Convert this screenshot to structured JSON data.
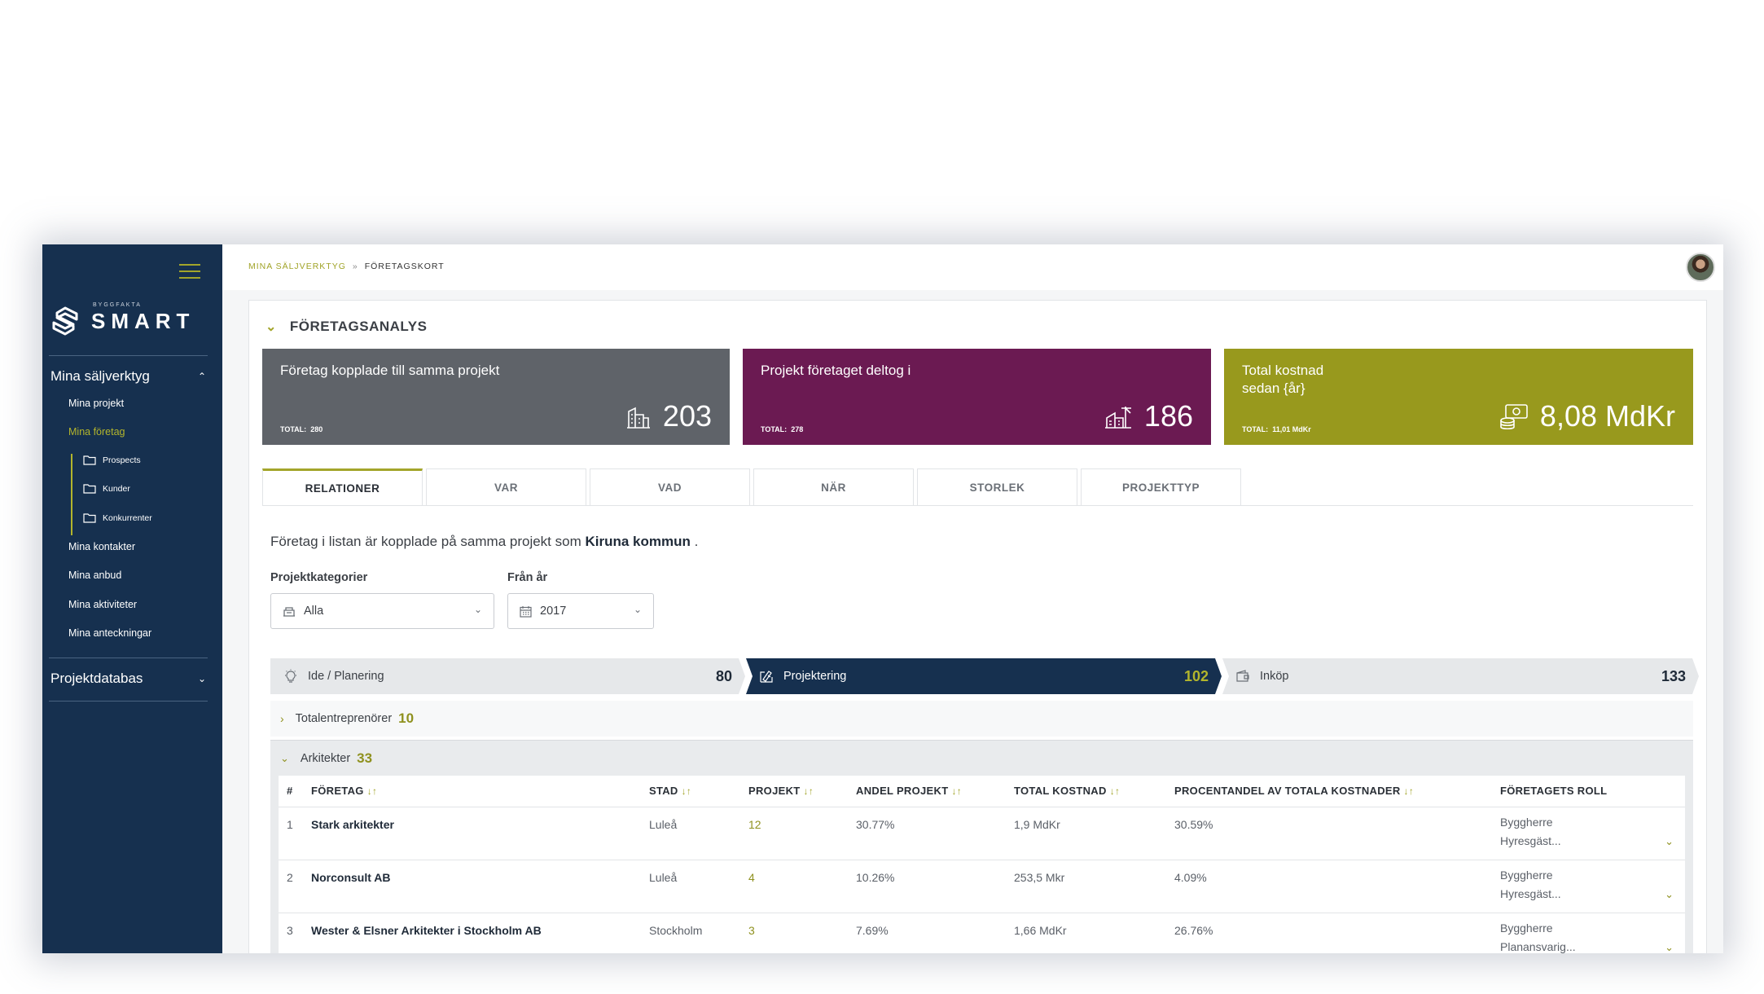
{
  "sidebar": {
    "logo_sub": "BYGGFAKTA",
    "logo_main": "SMART",
    "section1": "Mina säljverktyg",
    "items": [
      {
        "label": "Mina projekt"
      },
      {
        "label": "Mina företag"
      },
      {
        "label": "Mina kontakter"
      },
      {
        "label": "Mina anbud"
      },
      {
        "label": "Mina aktiviteter"
      },
      {
        "label": "Mina anteckningar"
      }
    ],
    "subitems": [
      {
        "label": "Prospects"
      },
      {
        "label": "Kunder"
      },
      {
        "label": "Konkurrenter"
      }
    ],
    "section2": "Projektdatabas"
  },
  "breadcrumb": {
    "root": "MINA SÄLJVERKTYG",
    "sep": "»",
    "current": "FÖRETAGSKORT"
  },
  "panel": {
    "title": "FÖRETAGSANALYS"
  },
  "cards": [
    {
      "title": "Företag kopplade till samma projekt",
      "total_label": "TOTAL:",
      "total": "280",
      "value": "203",
      "icon": "buildings-icon",
      "color": "#5f6369"
    },
    {
      "title": "Projekt företaget deltog i",
      "total_label": "TOTAL:",
      "total": "278",
      "value": "186",
      "icon": "construction-icon",
      "color": "#6b1a52"
    },
    {
      "title": "Total kostnad",
      "title2": "sedan {år}",
      "total_label": "TOTAL:",
      "total": "11,01 MdKr",
      "value": "8,08 MdKr",
      "icon": "money-icon",
      "color": "#98991d"
    }
  ],
  "tabs": [
    "RELATIONER",
    "VAR",
    "VAD",
    "NÄR",
    "STORLEK",
    "PROJEKTTYP"
  ],
  "info": {
    "pre": "Företag i listan är kopplade på samma projekt som",
    "company": "Kiruna kommun",
    "post": "."
  },
  "filters": {
    "category_label": "Projektkategorier",
    "category_value": "Alla",
    "year_label": "Från år",
    "year_value": "2017"
  },
  "stages": [
    {
      "label": "Ide / Planering",
      "count": "80"
    },
    {
      "label": "Projektering",
      "count": "102"
    },
    {
      "label": "Inköp",
      "count": "133"
    }
  ],
  "groups": [
    {
      "label": "Totalentreprenörer",
      "count": "10"
    },
    {
      "label": "Arkitekter",
      "count": "33"
    }
  ],
  "table": {
    "headers": [
      "#",
      "FÖRETAG",
      "STAD",
      "PROJEKT",
      "ANDEL PROJEKT",
      "TOTAL KOSTNAD",
      "PROCENTANDEL AV TOTALA KOSTNADER",
      "FÖRETAGETS ROLL"
    ],
    "rows": [
      {
        "num": "1",
        "company": "Stark arkitekter",
        "city": "Luleå",
        "projects": "12",
        "share": "30.77%",
        "cost": "1,9 MdKr",
        "pct": "30.59%",
        "role1": "Byggherre",
        "role2": "Hyresgäst..."
      },
      {
        "num": "2",
        "company": "Norconsult AB",
        "city": "Luleå",
        "projects": "4",
        "share": "10.26%",
        "cost": "253,5 Mkr",
        "pct": "4.09%",
        "role1": "Byggherre",
        "role2": "Hyresgäst..."
      },
      {
        "num": "3",
        "company": "Wester & Elsner Arkitekter i Stockholm AB",
        "city": "Stockholm",
        "projects": "3",
        "share": "7.69%",
        "cost": "1,66 MdKr",
        "pct": "26.76%",
        "role1": "Byggherre",
        "role2": "Planansvarig..."
      }
    ]
  }
}
